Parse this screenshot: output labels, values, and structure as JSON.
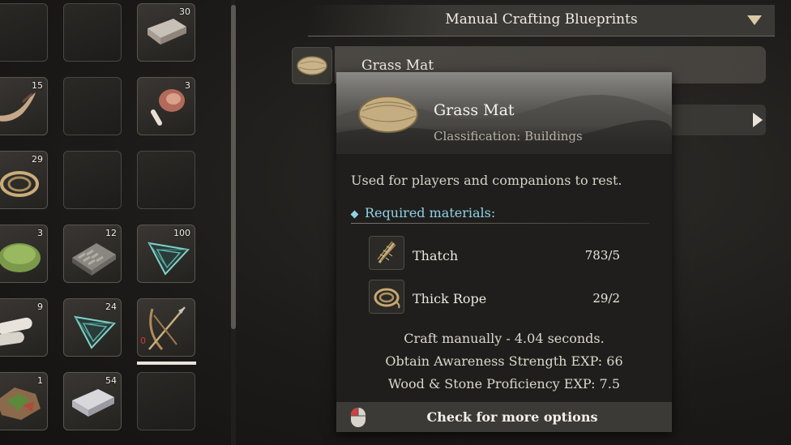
{
  "inventory": {
    "slots": [
      {
        "item": "",
        "qty": ""
      },
      {
        "item": "",
        "qty": ""
      },
      {
        "item": "iron-ingot-icon",
        "qty": "30"
      },
      {
        "item": "horn-icon",
        "qty": "15"
      },
      {
        "item": "",
        "qty": ""
      },
      {
        "item": "meat-leg-icon",
        "qty": "3"
      },
      {
        "item": "rope-coil-icon",
        "qty": "29"
      },
      {
        "item": "",
        "qty": ""
      },
      {
        "item": "",
        "qty": ""
      },
      {
        "item": "green-bowl-icon",
        "qty": "3"
      },
      {
        "item": "stone-block-icon",
        "qty": "12"
      },
      {
        "item": "crystal-frame-icon",
        "qty": "100"
      },
      {
        "item": "cloth-roll-icon",
        "qty": "9"
      },
      {
        "item": "crystal-frame-icon",
        "qty": "24"
      },
      {
        "item": "bow-spear-icon",
        "qty": "",
        "red": "0"
      },
      {
        "item": "ore-chunk-icon",
        "qty": "1"
      },
      {
        "item": "steel-ingot-icon",
        "qty": "54"
      },
      {
        "item": "",
        "qty": ""
      }
    ]
  },
  "header": {
    "title": "Manual Crafting Blueprints",
    "icon": "dropdown-triangle-icon"
  },
  "recipe_list": {
    "items": [
      {
        "label": "Grass Mat",
        "icon": "grass-mat-icon"
      }
    ]
  },
  "tooltip": {
    "title": "Grass Mat",
    "classification": "Classification: Buildings",
    "description": "Used for players and companions to rest.",
    "required_label": "Required materials:",
    "materials": [
      {
        "name": "Thatch",
        "count": "783/5",
        "icon": "thatch-icon"
      },
      {
        "name": "Thick Rope",
        "count": "29/2",
        "icon": "thick-rope-icon"
      }
    ],
    "craft_info": "Craft manually - 4.04 seconds.",
    "exp_awareness": "Obtain Awareness Strength EXP: 66",
    "exp_proficiency": "Wood & Stone Proficiency EXP: 7.5",
    "footer": "Check for more options",
    "footer_icon": "mouse-icon"
  },
  "colors": {
    "accent": "#8fd2e6",
    "panel": "#1f1e1c",
    "selected_bar": "#e8e4dc"
  }
}
